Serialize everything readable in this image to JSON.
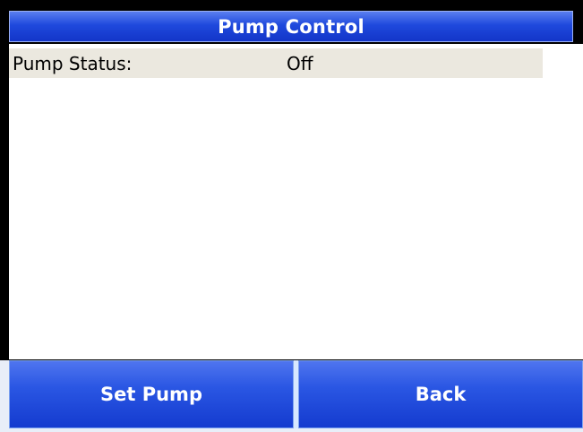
{
  "header": {
    "title": "Pump Control"
  },
  "status": {
    "label": "Pump Status:",
    "value": "Off"
  },
  "buttons": {
    "set_pump": "Set Pump",
    "back": "Back"
  },
  "colors": {
    "title_bar": "#1f49dd",
    "button": "#2a56e3",
    "row_background": "#ebe8df",
    "frame": "#000000"
  }
}
